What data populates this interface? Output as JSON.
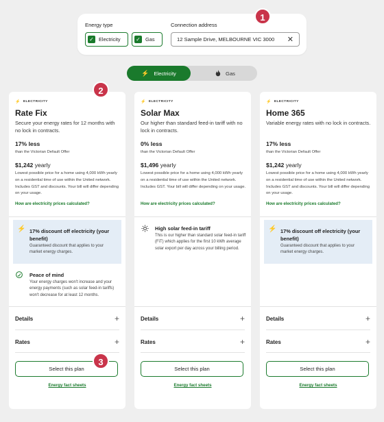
{
  "filter": {
    "energy_type_label": "Energy type",
    "options": [
      {
        "label": "Electricity",
        "checked": true
      },
      {
        "label": "Gas",
        "checked": true
      }
    ],
    "address_label": "Connection address",
    "address_value": "12 Sample Drive, MELBOURNE VIC 3000",
    "clear_icon": "close-icon"
  },
  "badges": [
    "1",
    "2",
    "3"
  ],
  "toggle": {
    "electricity": "Electricity",
    "gas": "Gas",
    "active": "Electricity"
  },
  "plans": [
    {
      "type": "ELECTRICITY",
      "name": "Rate Fix",
      "desc": "Secure your energy rates for 12 months with no lock in contracts.",
      "discount": "17% less",
      "vdo": "than the Victorian Default Offer",
      "price": "$1,242",
      "price_unit": "yearly",
      "price_desc": "Lowest possible price for a home using 4,000 kWh yearly on a residential time of use within the United network. Includes GST and discounts. Your bill will differ depending on your usage.",
      "link": "How are electricity prices calculated?",
      "benefits": [
        {
          "icon": "lightning-icon",
          "title": "17% discount off electricity (your benefit)",
          "desc": "Guaranteed discount that applies to your market energy charges."
        },
        {
          "icon": "leaf-badge-icon",
          "title": "Peace of mind",
          "desc": "Your energy charges won't increase and your energy payments (such as solar feed-in tariffs) won't decrease for at least 12 months."
        }
      ]
    },
    {
      "type": "ELECTRICITY",
      "name": "Solar Max",
      "desc": "Our higher than standard feed-in tariff with no lock in contracts.",
      "discount": "0% less",
      "vdo": "than the Victorian Default Offer",
      "price": "$1,496",
      "price_unit": "yearly",
      "price_desc": "Lowest possible price for a home using 4,000 kWh yearly on a residential time of use within the United network. Includes GST. Your bill will differ depending on your usage.",
      "link": "How are electricity prices calculated?",
      "benefits": [
        {
          "icon": "sun-icon",
          "title": "High solar feed-in tariff",
          "desc": "This is our higher than standard solar feed-in tariff (FiT) which applies for the first 10 kWh average solar export per day across your billing period."
        }
      ]
    },
    {
      "type": "ELECTRICITY",
      "name": "Home 365",
      "desc": "Variable energy rates with no lock in contracts.",
      "discount": "17% less",
      "vdo": "than the Victorian Default Offer",
      "price": "$1,242",
      "price_unit": "yearly",
      "price_desc": "Lowest possible price for a home using 4,000 kWh yearly on a residential time of use within the United network. Includes GST and discounts. Your bill will differ depending on your usage.",
      "link": "How are electricity prices calculated?",
      "benefits": [
        {
          "icon": "lightning-icon",
          "title": "17% discount off electricity (your benefit)",
          "desc": "Guaranteed discount that applies to your market energy charges."
        }
      ]
    }
  ],
  "card_common": {
    "details": "Details",
    "rates": "Rates",
    "select": "Select this plan",
    "fact": "Energy fact sheets",
    "plus": "+"
  }
}
